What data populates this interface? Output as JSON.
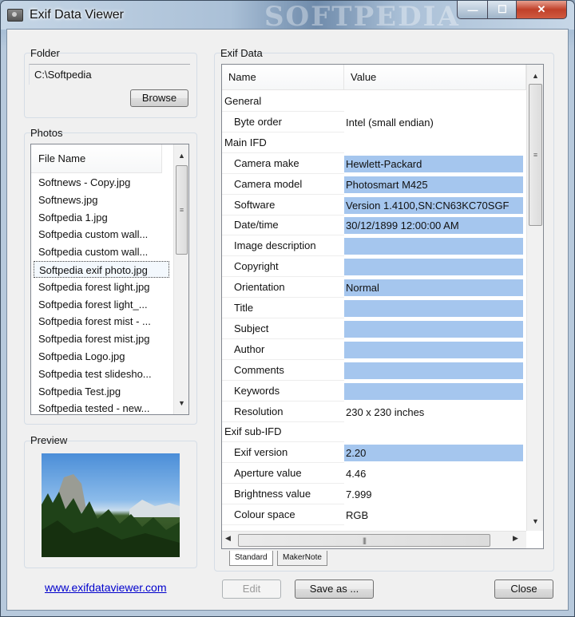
{
  "window": {
    "title": "Exif Data Viewer",
    "watermark": "SOFTPEDIA"
  },
  "titlebar_buttons": {
    "minimize": "—",
    "maximize": "☐",
    "close": "✕"
  },
  "folder": {
    "label": "Folder",
    "path": "C:\\Softpedia",
    "browse_label": "Browse"
  },
  "photos": {
    "label": "Photos",
    "column_header": "File Name",
    "files": [
      "Softnews - Copy.jpg",
      "Softnews.jpg",
      "Softpedia 1.jpg",
      "Softpedia custom wall...",
      "Softpedia custom wall...",
      "Softpedia exif photo.jpg",
      "Softpedia forest light.jpg",
      "Softpedia forest light_...",
      "Softpedia forest mist - ...",
      "Softpedia forest mist.jpg",
      "Softpedia Logo.jpg",
      "Softpedia test slidesho...",
      "Softpedia Test.jpg",
      "Softpedia tested - new..."
    ],
    "selected_index": 5
  },
  "preview": {
    "label": "Preview"
  },
  "exif": {
    "label": "Exif Data",
    "columns": [
      "Name",
      "Value"
    ],
    "rows": [
      {
        "name": "General",
        "value": "",
        "group": true,
        "highlight": false
      },
      {
        "name": "Byte order",
        "value": "Intel (small endian)",
        "group": false,
        "highlight": false
      },
      {
        "name": "Main IFD",
        "value": "",
        "group": true,
        "highlight": false
      },
      {
        "name": "Camera make",
        "value": "Hewlett-Packard",
        "group": false,
        "highlight": true
      },
      {
        "name": "Camera model",
        "value": "Photosmart M425",
        "group": false,
        "highlight": true
      },
      {
        "name": "Software",
        "value": "Version 1.4100,SN:CN63KC70SGF",
        "group": false,
        "highlight": true
      },
      {
        "name": "Date/time",
        "value": "30/12/1899 12:00:00 AM",
        "group": false,
        "highlight": true
      },
      {
        "name": "Image description",
        "value": "",
        "group": false,
        "highlight": true
      },
      {
        "name": "Copyright",
        "value": "",
        "group": false,
        "highlight": true
      },
      {
        "name": "Orientation",
        "value": "Normal",
        "group": false,
        "highlight": true
      },
      {
        "name": "Title",
        "value": "",
        "group": false,
        "highlight": true
      },
      {
        "name": "Subject",
        "value": "",
        "group": false,
        "highlight": true
      },
      {
        "name": "Author",
        "value": "",
        "group": false,
        "highlight": true
      },
      {
        "name": "Comments",
        "value": "",
        "group": false,
        "highlight": true
      },
      {
        "name": "Keywords",
        "value": "",
        "group": false,
        "highlight": true
      },
      {
        "name": "Resolution",
        "value": "230 x 230 inches",
        "group": false,
        "highlight": false
      },
      {
        "name": "Exif sub-IFD",
        "value": "",
        "group": true,
        "highlight": false
      },
      {
        "name": "Exif version",
        "value": "2.20",
        "group": false,
        "highlight": true
      },
      {
        "name": "Aperture value",
        "value": "4.46",
        "group": false,
        "highlight": false
      },
      {
        "name": "Brightness value",
        "value": "7.999",
        "group": false,
        "highlight": false
      },
      {
        "name": "Colour space",
        "value": "RGB",
        "group": false,
        "highlight": false
      }
    ],
    "tabs": [
      "Standard",
      "MakerNote"
    ]
  },
  "footer": {
    "link": "www.exifdataviewer.com",
    "edit_label": "Edit",
    "save_label": "Save as ...",
    "close_label": "Close"
  },
  "colors": {
    "highlight": "#a5c6ee",
    "link": "#0000cc"
  }
}
